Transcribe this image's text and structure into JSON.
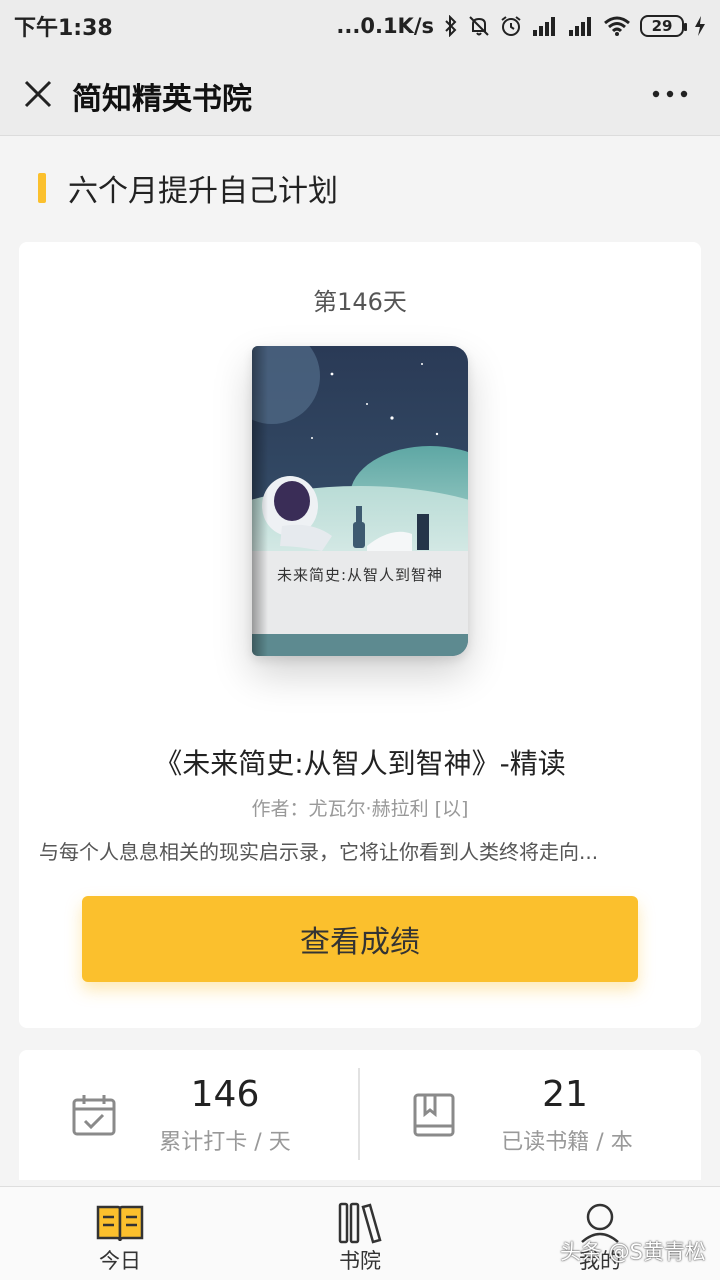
{
  "status_bar": {
    "time": "下午1:38",
    "network_speed": "...0.1K/s",
    "battery": "29"
  },
  "nav": {
    "title": "简知精英书院"
  },
  "section": {
    "title": "六个月提升自己计划"
  },
  "book": {
    "day": "第146天",
    "cover_title": "未来简史:从智人到智神",
    "title": "《未来简史:从智人到智神》-精读",
    "author": "作者：尤瓦尔·赫拉利 [以]",
    "description": "与每个人息息相关的现实启示录，它将让你看到人类终将走向...",
    "button_label": "查看成绩"
  },
  "stats": {
    "checkin_value": "146",
    "checkin_label": "累计打卡 / 天",
    "books_value": "21",
    "books_label": "已读书籍 / 本"
  },
  "tabs": [
    {
      "label": "今日",
      "icon": "open-book-icon",
      "active": true
    },
    {
      "label": "书院",
      "icon": "bookshelf-icon",
      "active": false
    },
    {
      "label": "我的",
      "icon": "user-icon",
      "active": false
    }
  ],
  "watermark": "头条 @S黄青松",
  "colors": {
    "accent": "#fbc02d",
    "cover_sky": "#2f4563",
    "cover_planet": "#6fb3ad"
  }
}
